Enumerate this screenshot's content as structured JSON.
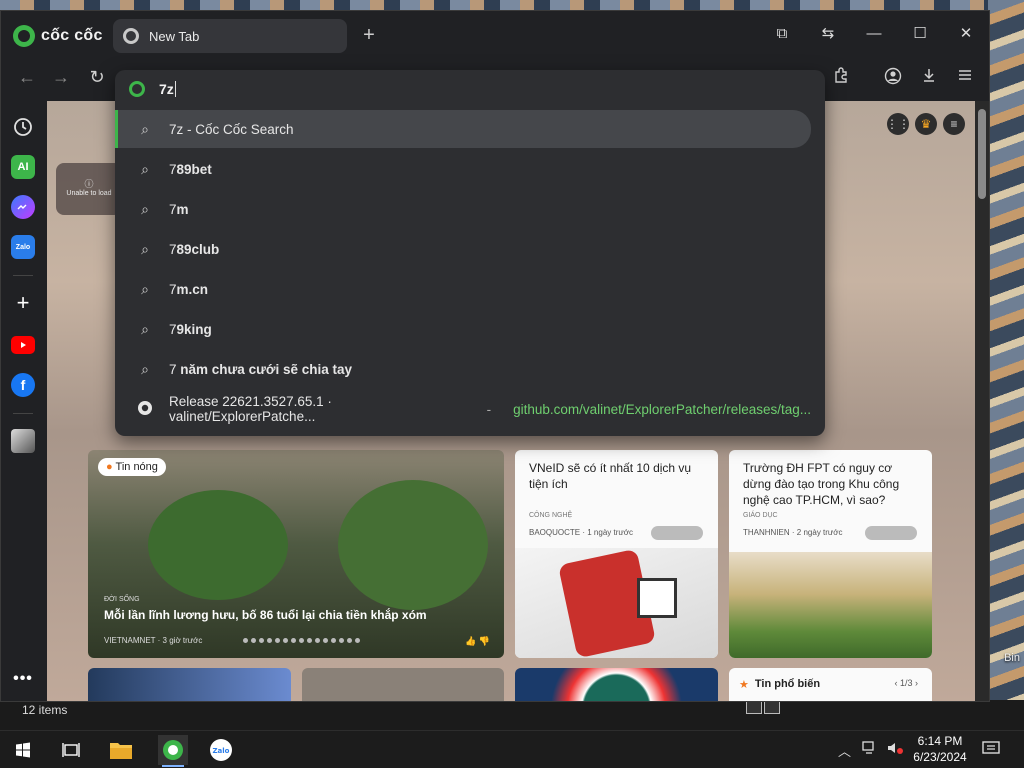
{
  "browser": {
    "brand": "cốc cốc",
    "tab_title": "New Tab",
    "new_tab_symbol": "+",
    "window_controls": {
      "cast": "⧉",
      "side": "⇆",
      "minimize": "—",
      "maximize": "☐",
      "close": "✕"
    }
  },
  "toolbar": {
    "back": "←",
    "forward": "→",
    "reload": "↻"
  },
  "omnibox": {
    "value": "7z",
    "suggestions": [
      {
        "pre": "7z",
        "bold": "",
        "post": " - Cốc Cốc Search",
        "icon": "search-icon"
      },
      {
        "pre": "7",
        "bold": "89bet",
        "post": "",
        "icon": "search-icon"
      },
      {
        "pre": "7",
        "bold": "m",
        "post": "",
        "icon": "search-icon"
      },
      {
        "pre": "7",
        "bold": "89club",
        "post": "",
        "icon": "search-icon"
      },
      {
        "pre": "7",
        "bold": "m.cn",
        "post": "",
        "icon": "search-icon"
      },
      {
        "pre": "7",
        "bold": "9king",
        "post": "",
        "icon": "search-icon"
      },
      {
        "pre": "7",
        "bold": " năm chưa cưới sẽ chia tay",
        "post": "",
        "icon": "search-icon"
      }
    ],
    "history": {
      "title": "Release 22621.3527.65.1 · valinet/ExplorerPatche...",
      "separator": "-",
      "url": "github.com/valinet/ExplorerPatcher/releases/tag..."
    }
  },
  "content": {
    "unable_text": "Unable to load",
    "big_card": {
      "tag": "Tin nóng",
      "category": "ĐỜI SỐNG",
      "headline": "Mỗi lần lĩnh lương hưu, bố 86 tuổi lại chia tiền khắp xóm",
      "source": "VIETNAMNET",
      "time": "· 3 giờ trước"
    },
    "card2": {
      "title": "VNeID sẽ có ít nhất 10 dịch vụ tiện ích",
      "category": "CÔNG NGHỆ",
      "source": "BAOQUOCTE",
      "time": "· 1 ngày trước"
    },
    "card3": {
      "title": "Trường ĐH FPT có nguy cơ dừng đào tạo trong Khu công nghệ cao TP.HCM, vì sao?",
      "category": "GIÁO DỤC",
      "source": "THANHNIEN",
      "time": "· 2 ngày trước"
    },
    "popular": {
      "label": "Tin phổ biến",
      "page": "1/3"
    }
  },
  "explorer": {
    "items_count": "12 items",
    "desktop_label": "Bin"
  },
  "taskbar": {
    "time": "6:14 PM",
    "date": "6/23/2024"
  },
  "colors": {
    "accent": "#3db54a",
    "url_green": "#6fcf6f",
    "bg": "#202124"
  }
}
